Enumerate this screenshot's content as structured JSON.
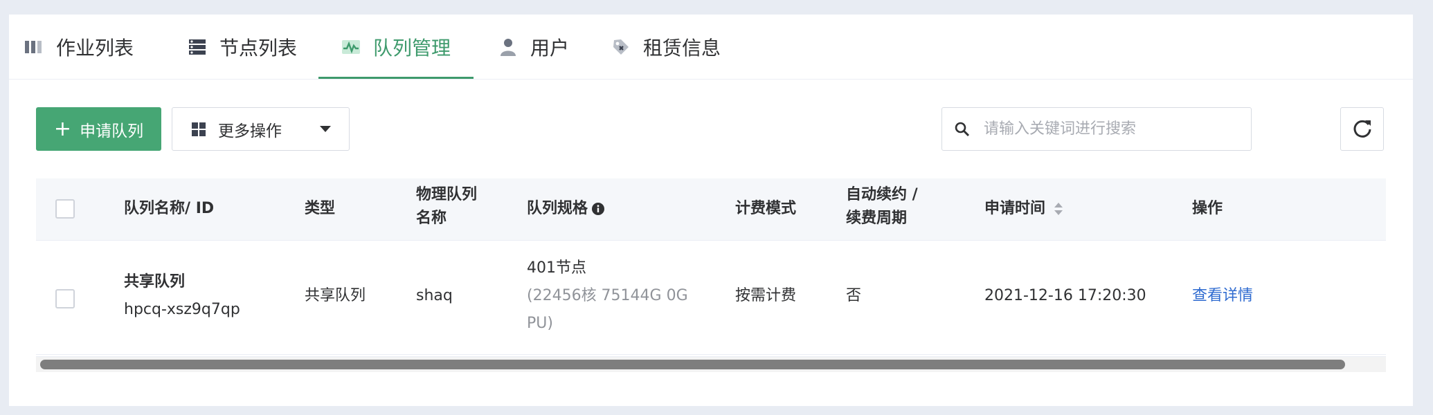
{
  "tabs": [
    {
      "label": "作业列表",
      "icon": "job-list-icon",
      "active": false
    },
    {
      "label": "节点列表",
      "icon": "node-list-icon",
      "active": false
    },
    {
      "label": "队列管理",
      "icon": "queue-management-icon",
      "active": true
    },
    {
      "label": "用户",
      "icon": "user-icon",
      "active": false
    },
    {
      "label": "租赁信息",
      "icon": "lease-tag-icon",
      "active": false
    }
  ],
  "toolbar": {
    "apply_label": "申请队列",
    "more_label": "更多操作",
    "search_placeholder": "请输入关键词进行搜索"
  },
  "table": {
    "headers": {
      "name": "队列名称/ ID",
      "type": "类型",
      "physical_line1": "物理队列",
      "physical_line2": "名称",
      "spec": "队列规格",
      "billing": "计费模式",
      "renew_line1": "自动续约 /",
      "renew_line2": "续费周期",
      "apply_time": "申请时间",
      "actions": "操作"
    },
    "rows": [
      {
        "name": "共享队列",
        "id": "hpcq-xsz9q7qp",
        "type": "共享队列",
        "physical": "shaq",
        "spec_nodes": "401节点",
        "spec_detail_line1": "(22456核 75144G 0G",
        "spec_detail_line2": "PU)",
        "billing": "按需计费",
        "auto_renew": "否",
        "apply_time": "2021-12-16 17:20:30",
        "action": "查看详情"
      }
    ]
  },
  "colors": {
    "accent": "#46a674",
    "active_tab": "#3e9a6c",
    "link": "#2f6bd0",
    "background": "#e8ecf3"
  }
}
